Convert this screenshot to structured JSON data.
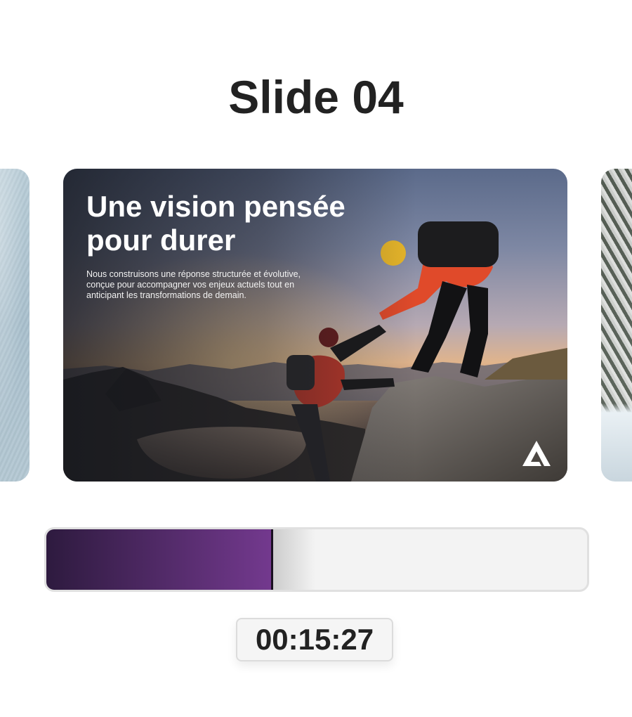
{
  "header": {
    "slide_title": "Slide 04"
  },
  "slide": {
    "heading": "Une vision pensée pour durer",
    "body": "Nous construisons une réponse structurée et évolutive, conçue pour accompagner vos enjeux actuels tout en anticipant les transformations de demain.",
    "logo_icon": "a-logo-icon"
  },
  "progress": {
    "fraction": 0.42,
    "fill_colors": [
      "#2d1a3e",
      "#73398e"
    ]
  },
  "timer": {
    "value": "00:15:27"
  }
}
